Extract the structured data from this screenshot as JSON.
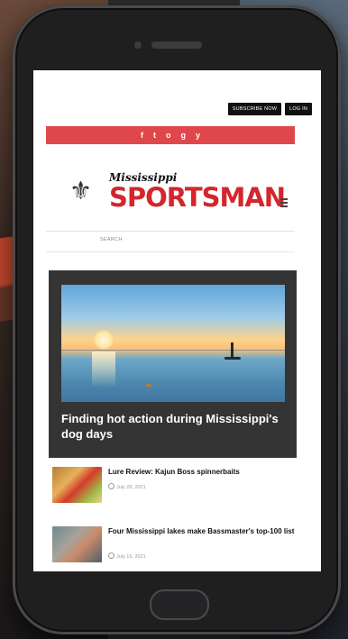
{
  "header": {
    "subscribe_label": "SUBSCRIBE NOW",
    "login_label": "LOG IN"
  },
  "social": [
    "f",
    "t",
    "o",
    "g",
    "y"
  ],
  "logo": {
    "top_text": "Mississippi",
    "main_text": "SPORTSMAN",
    "mark": "⚜"
  },
  "search": {
    "placeholder": "SEARCH"
  },
  "featured": {
    "title": "Finding hot action during Mississippi's dog days"
  },
  "articles": [
    {
      "title": "Lure Review: Kajun Boss spinnerbaits",
      "date": "July 28, 2021"
    },
    {
      "title": "Four Mississippi lakes make Bassmaster's top-100 list",
      "date": "July 15, 2021"
    }
  ],
  "colors": {
    "accent": "#e0474c",
    "brand_red": "#d3262d",
    "feature_bg": "#343434"
  },
  "icons": {
    "social": [
      "facebook-icon",
      "twitter-icon",
      "instagram-icon",
      "pinterest-icon",
      "youtube-icon"
    ],
    "menu": "hamburger-menu-icon",
    "date": "clock-icon"
  }
}
